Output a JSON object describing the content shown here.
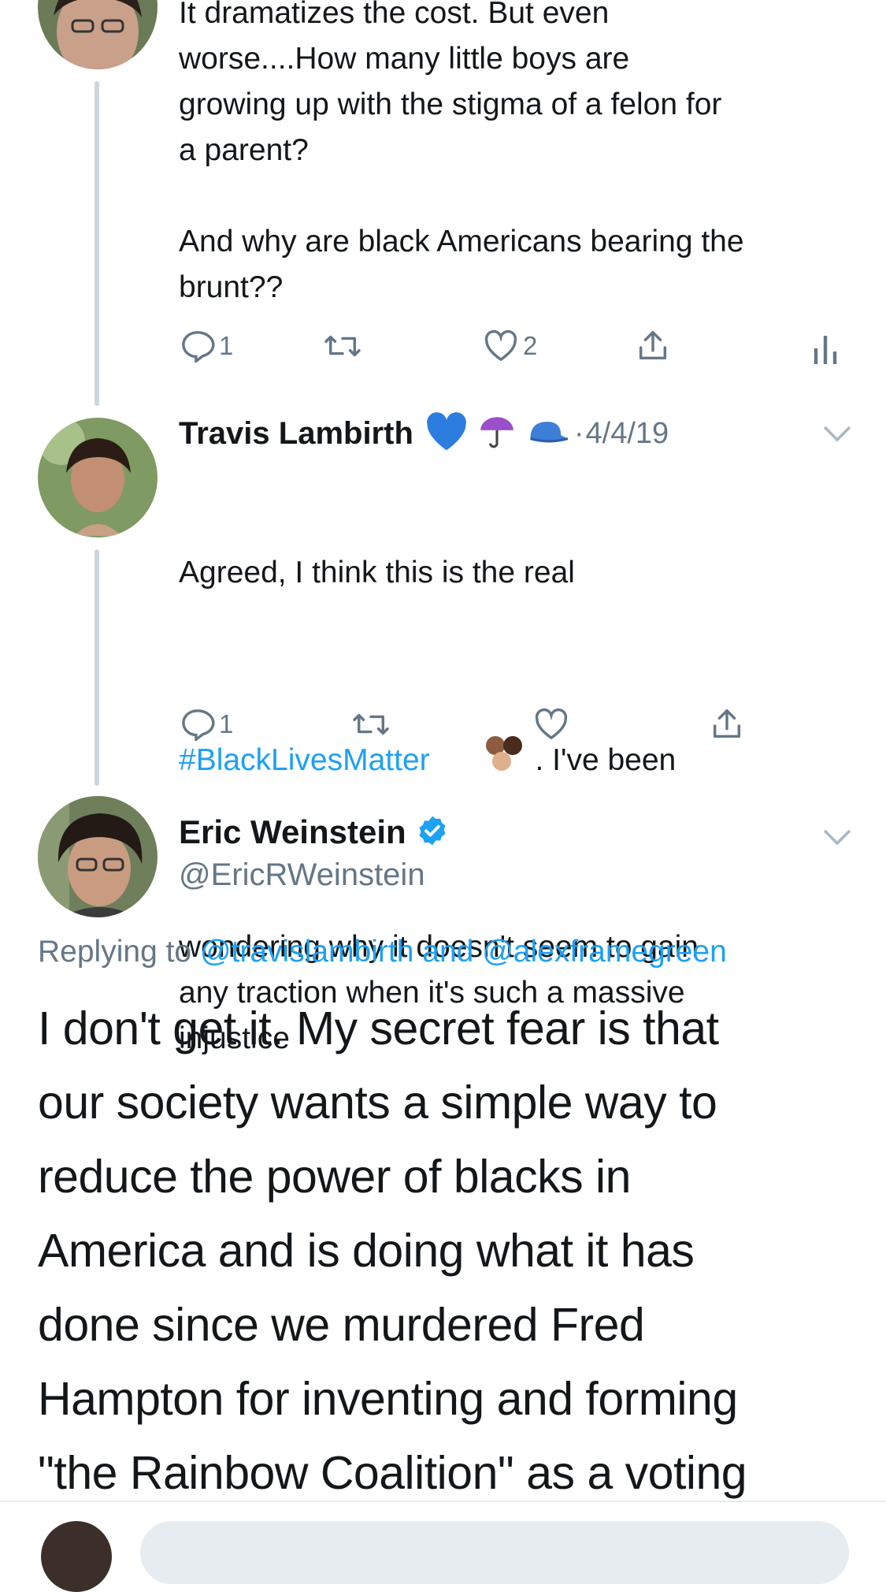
{
  "tweet1": {
    "text": "It dramatizes the cost. But even\nworse....How many little boys are\ngrowing up with the stigma of a felon for\na parent?\n\nAnd why are black Americans bearing the\nbrunt??",
    "reply_count": "1",
    "like_count": "2"
  },
  "tweet2": {
    "author_name": "Travis Lambirth",
    "date": "4/4/19",
    "text_before_hashtag": "Agreed, I think this is the real",
    "hashtag": "#BlackLivesMatter",
    "text_after_hashtag": " . I've been",
    "text_rest": "wondering why it doesn't seem to gain\nany traction when it's such a massive\ninjustice",
    "reply_count": "1",
    "emoji": [
      "blue-heart",
      "umbrella",
      "cap"
    ]
  },
  "main_tweet": {
    "author_name": "Eric Weinstein",
    "handle": "@EricRWeinstein",
    "replying_prefix": "Replying to ",
    "reply_to_1": "@travislambirth",
    "reply_and": " and ",
    "reply_to_2": "@alexframegreen",
    "text": "I don't get it. My secret fear is that\nour society wants a simple way to\nreduce the power of blacks in\nAmerica and is doing what it has\ndone since we murdered Fred\nHampton for inventing and forming\n\"the Rainbow Coalition\" as a voting"
  },
  "colors": {
    "accent": "#1da1f2",
    "muted": "#657786",
    "line": "#ccd6dd",
    "verified": "#1da1f2"
  }
}
